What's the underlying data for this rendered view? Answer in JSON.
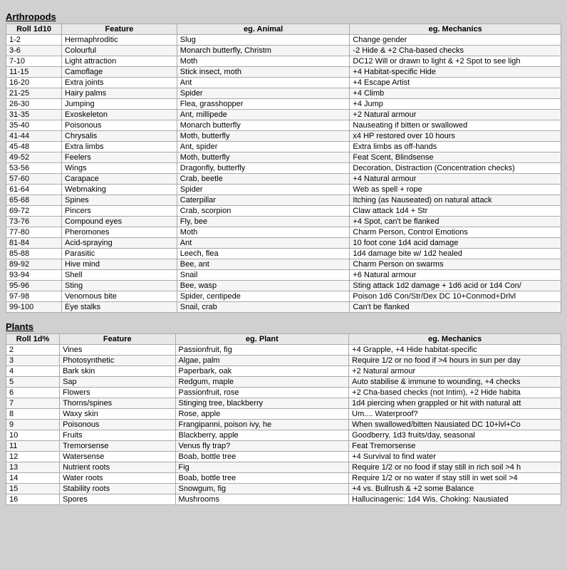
{
  "arthropods": {
    "title": "Arthropods",
    "headers": [
      "Roll 1d10",
      "Feature",
      "eg. Animal",
      "eg. Mechanics"
    ],
    "rows": [
      [
        "1-2",
        "Hermaphroditic",
        "Slug",
        "Change gender"
      ],
      [
        "3-6",
        "Colourful",
        "Monarch butterfly, Christm",
        "-2 Hide & +2 Cha-based checks"
      ],
      [
        "7-10",
        "Light attraction",
        "Moth",
        "DC12 Will or drawn to light & +2 Spot to see ligh"
      ],
      [
        "11-15",
        "Camoflage",
        "Stick insect, moth",
        "+4 Habitat-specific Hide"
      ],
      [
        "16-20",
        "Extra joints",
        "Ant",
        "+4 Escape Artist"
      ],
      [
        "21-25",
        "Hairy palms",
        "Spider",
        "+4 Climb"
      ],
      [
        "26-30",
        "Jumping",
        "Flea, grasshopper",
        "+4 Jump"
      ],
      [
        "31-35",
        "Exoskeleton",
        "Ant, millipede",
        "+2 Natural armour"
      ],
      [
        "35-40",
        "Poisonous",
        "Monarch butterfly",
        "Nauseating if bitten or swallowed"
      ],
      [
        "41-44",
        "Chrysalis",
        "Moth, butterfly",
        "x4 HP restored over 10 hours"
      ],
      [
        "45-48",
        "Extra limbs",
        "Ant, spider",
        "Extra limbs as off-hands"
      ],
      [
        "49-52",
        "Feelers",
        "Moth, butterfly",
        "Feat Scent, Blindsense"
      ],
      [
        "53-56",
        "Wings",
        "Dragonfly, butterfly",
        "Decoration, Distraction (Concentration checks)"
      ],
      [
        "57-60",
        "Carapace",
        "Crab, beetle",
        "+4 Natural armour"
      ],
      [
        "61-64",
        "Webmaking",
        "Spider",
        "Web as spell + rope"
      ],
      [
        "65-68",
        "Spines",
        "Caterpillar",
        "Itching (as Nauseated) on natural attack"
      ],
      [
        "69-72",
        "Pincers",
        "Crab, scorpion",
        "Claw attack 1d4 + Str"
      ],
      [
        "73-76",
        "Compound eyes",
        "Fly, bee",
        "+4 Spot, can't be flanked"
      ],
      [
        "77-80",
        "Pheromones",
        "Moth",
        "Charm Person, Control Emotions"
      ],
      [
        "81-84",
        "Acid-spraying",
        "Ant",
        "10 foot cone 1d4 acid damage"
      ],
      [
        "85-88",
        "Parasitic",
        "Leech, flea",
        "1d4 damage bite w/ 1d2 healed"
      ],
      [
        "89-92",
        "Hive mind",
        "Bee, ant",
        "Charm Person on swarms"
      ],
      [
        "93-94",
        "Shell",
        "Snail",
        "+6 Natural armour"
      ],
      [
        "95-96",
        "Sting",
        "Bee, wasp",
        "Sting attack 1d2 damage + 1d6 acid or 1d4 Con/"
      ],
      [
        "97-98",
        "Venomous bite",
        "Spider, centipede",
        "Poison 1d6 Con/Str/Dex DC 10+Conmod+Drlvl"
      ],
      [
        "99-100",
        "Eye stalks",
        "Snail, crab",
        "Can't be flanked"
      ]
    ]
  },
  "plants": {
    "title": "Plants",
    "headers": [
      "Roll 1d%",
      "Feature",
      "eg. Plant",
      "eg. Mechanics"
    ],
    "rows": [
      [
        "2",
        "Vines",
        "Passionfruit, fig",
        "+4 Grapple, +4 Hide habitat-specific"
      ],
      [
        "3",
        "Photosynthetic",
        "Algae, palm",
        "Require 1/2 or no food if >4 hours in sun per day"
      ],
      [
        "4",
        "Bark skin",
        "Paperbark, oak",
        "+2 Natural armour"
      ],
      [
        "5",
        "Sap",
        "Redgum, maple",
        "Auto stabilise & immune to wounding, +4 checks"
      ],
      [
        "6",
        "Flowers",
        "Passionfruit, rose",
        "+2 Cha-based checks (not Intim), +2 Hide habita"
      ],
      [
        "7",
        "Thorns/spines",
        "Stinging tree, blackberry",
        "1d4 piercing when grappled or hit with natural att"
      ],
      [
        "8",
        "Waxy skin",
        "Rose, apple",
        "Um.... Waterproof?"
      ],
      [
        "9",
        "Poisonous",
        "Frangipanni, poison ivy, he",
        "When swallowed/bitten Nausiated DC 10+lvl+Co"
      ],
      [
        "10",
        "Fruits",
        "Blackberry, apple",
        "Goodberry, 1d3 fruits/day, seasonal"
      ],
      [
        "11",
        "Tremorsense",
        "Venus fly trap?",
        "Feat Tremorsense"
      ],
      [
        "12",
        "Watersense",
        "Boab, bottle tree",
        "+4 Survival to find water"
      ],
      [
        "13",
        "Nutrient roots",
        "Fig",
        "Require 1/2 or no food if stay still in rich soil >4 h"
      ],
      [
        "14",
        "Water roots",
        "Boab, bottle tree",
        "Require 1/2 or no water if stay still in wet soil >4"
      ],
      [
        "15",
        "Stability roots",
        "Snowgum, fig",
        "+4 vs. Bullrush & +2 some Balance"
      ],
      [
        "16",
        "Spores",
        "Mushrooms",
        "Hallucinagenic: 1d4 Wis, Choking: Nausiated"
      ]
    ]
  }
}
